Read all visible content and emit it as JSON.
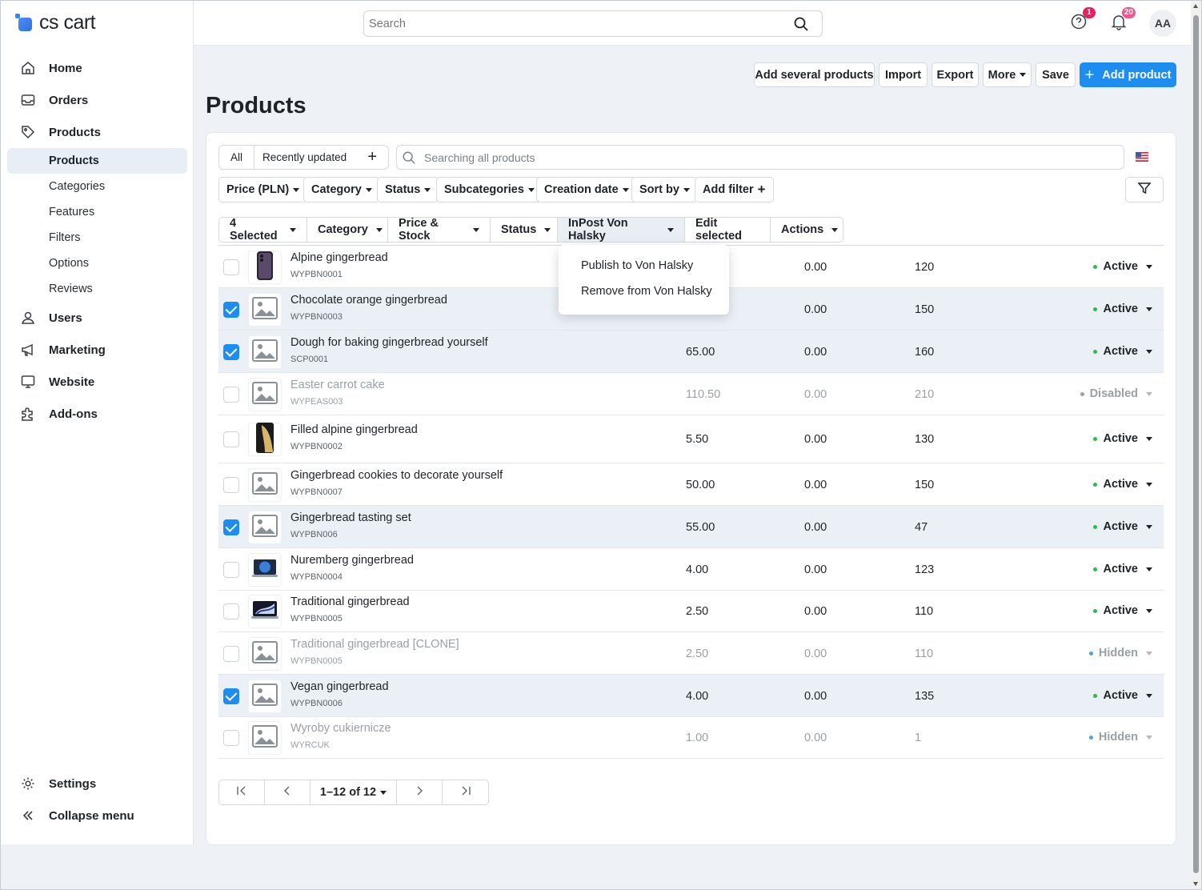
{
  "brand": {
    "logo_text": "cs cart",
    "accent": "#1d8ef0"
  },
  "sidebar": {
    "nav": [
      {
        "label": "Home",
        "icon": "home-icon"
      },
      {
        "label": "Orders",
        "icon": "inbox-icon"
      },
      {
        "label": "Products",
        "icon": "tag-icon"
      }
    ],
    "sub": [
      "Products",
      "Categories",
      "Features",
      "Filters",
      "Options",
      "Reviews"
    ],
    "nav2": [
      {
        "label": "Users",
        "icon": "user-icon"
      },
      {
        "label": "Marketing",
        "icon": "megaphone-icon"
      },
      {
        "label": "Website",
        "icon": "monitor-icon"
      },
      {
        "label": "Add-ons",
        "icon": "puzzle-icon"
      }
    ],
    "settings": "Settings",
    "collapse": "Collapse menu"
  },
  "topbar": {
    "search_placeholder": "Search",
    "help_badge": "1",
    "notif_badge": "20",
    "avatar": "AA"
  },
  "actions": {
    "add_several": "Add several products",
    "import": "Import",
    "export": "Export",
    "more": "More",
    "save": "Save",
    "add_product": "Add product"
  },
  "page_title": "Products",
  "tabs": {
    "all": "All",
    "recent": "Recently updated",
    "add": "+"
  },
  "product_search_placeholder": "Searching all products",
  "filters": [
    "Price (PLN)",
    "Category",
    "Status",
    "Subcategories",
    "Creation date",
    "Sort by"
  ],
  "add_filter": "Add filter",
  "bulk": {
    "selected": "4 Selected",
    "category": "Category",
    "price_stock": "Price & Stock",
    "status": "Status",
    "inpost": "InPost Von Halsky",
    "edit_selected": "Edit selected",
    "actions": "Actions"
  },
  "dropdown": {
    "publish": "Publish to Von Halsky",
    "remove": "Remove from Von Halsky"
  },
  "products": [
    {
      "name": "Alpine gingerbread",
      "code": "WYPBN0001",
      "price": "",
      "list": "0.00",
      "qty": "120",
      "status": "Active",
      "checked": false,
      "thumb": "phone-dark"
    },
    {
      "name": "Chocolate orange gingerbread",
      "code": "WYPBN0003",
      "price": "",
      "list": "0.00",
      "qty": "150",
      "status": "Active",
      "checked": true,
      "thumb": "placeholder"
    },
    {
      "name": "Dough for baking gingerbread yourself",
      "code": "SCP0001",
      "price": "65.00",
      "list": "0.00",
      "qty": "160",
      "status": "Active",
      "checked": true,
      "thumb": "placeholder"
    },
    {
      "name": "Easter carrot cake",
      "code": "WYPEAS003",
      "price": "110.50",
      "list": "0.00",
      "qty": "210",
      "status": "Disabled",
      "checked": false,
      "thumb": "placeholder"
    },
    {
      "name": "Filled alpine gingerbread",
      "code": "WYPBN0002",
      "price": "5.50",
      "list": "0.00",
      "qty": "130",
      "status": "Active",
      "checked": false,
      "thumb": "phone-gold"
    },
    {
      "name": "Gingerbread cookies to decorate yourself",
      "code": "WYPBN0007",
      "price": "50.00",
      "list": "0.00",
      "qty": "150",
      "status": "Active",
      "checked": false,
      "thumb": "placeholder"
    },
    {
      "name": "Gingerbread tasting set",
      "code": "WYPBN006",
      "price": "55.00",
      "list": "0.00",
      "qty": "47",
      "status": "Active",
      "checked": true,
      "thumb": "placeholder"
    },
    {
      "name": "Nuremberg gingerbread",
      "code": "WYPBN0004",
      "price": "4.00",
      "list": "0.00",
      "qty": "123",
      "status": "Active",
      "checked": false,
      "thumb": "laptop-blue"
    },
    {
      "name": "Traditional gingerbread",
      "code": "WYPBN0005",
      "price": "2.50",
      "list": "0.00",
      "qty": "110",
      "status": "Active",
      "checked": false,
      "thumb": "laptop-dark"
    },
    {
      "name": "Traditional gingerbread [CLONE]",
      "code": "WYPBN0005",
      "price": "2.50",
      "list": "0.00",
      "qty": "110",
      "status": "Hidden",
      "checked": false,
      "thumb": "placeholder"
    },
    {
      "name": "Vegan gingerbread",
      "code": "WYPBN0006",
      "price": "4.00",
      "list": "0.00",
      "qty": "135",
      "status": "Active",
      "checked": true,
      "thumb": "placeholder"
    },
    {
      "name": "Wyroby cukiernicze",
      "code": "WYRCUK",
      "price": "1.00",
      "list": "0.00",
      "qty": "1",
      "status": "Hidden",
      "checked": false,
      "thumb": "placeholder"
    }
  ],
  "status_colors": {
    "Active": "#2dbb4b",
    "Disabled": "#9aa0a6",
    "Hidden": "#4aa3df"
  },
  "pager": {
    "range": "1–12 of 12"
  }
}
